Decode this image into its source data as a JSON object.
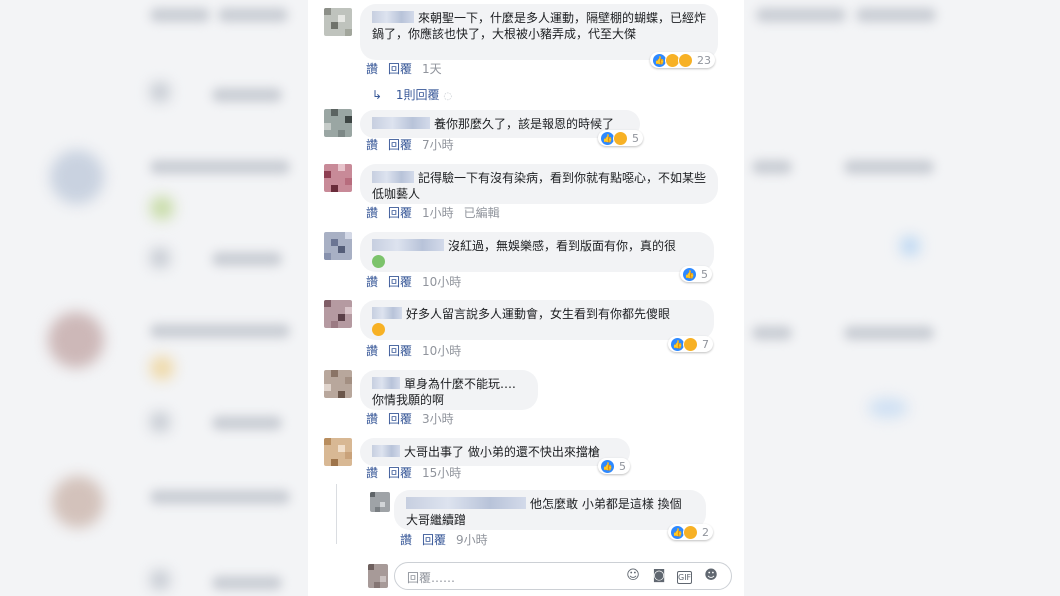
{
  "colors": {
    "link": "#385898",
    "meta_grey": "#90949c",
    "bubble_bg": "#f2f3f5",
    "like_blue": "#2e89ff",
    "haha_yellow": "#f7b125"
  },
  "actions": {
    "like": "讚",
    "reply": "回覆"
  },
  "comments": [
    {
      "text": "來朝聖一下，什麼是多人運動，隔壁棚的蝴蝶，已經炸鍋了，你應該也快了，大根被小豬弄成，代至大傑",
      "time": "1天",
      "reaction_count": "23",
      "reaction_icons": [
        "like-icon",
        "haha-icon",
        "wow-icon"
      ]
    },
    {
      "text": "養你那麼久了，該是報恩的時候了",
      "time": "7小時",
      "reaction_count": "5",
      "reaction_icons": [
        "like-icon",
        "haha-icon"
      ]
    },
    {
      "text": "記得驗一下有沒有染病，看到你就有點噁心，不如某些低咖藝人",
      "time": "1小時",
      "edited": "已編輯"
    },
    {
      "text": "沒紅過，無娛樂感，看到版面有你，真的很",
      "emoji": "nauseated-face-emoji",
      "time": "10小時",
      "reaction_count": "5",
      "reaction_icons": [
        "like-icon"
      ]
    },
    {
      "text": "好多人留言說多人運動會，女生看到有你都先傻眼",
      "emoji": "grimacing-face-emoji",
      "time": "10小時",
      "reaction_count": "7",
      "reaction_icons": [
        "like-icon",
        "haha-icon"
      ]
    },
    {
      "text_line1": "單身為什麼不能玩….",
      "text_line2": "你情我願的啊",
      "time": "3小時"
    },
    {
      "text": "大哥出事了 做小弟的還不快出來擋槍",
      "time": "15小時",
      "reaction_count": "5",
      "reaction_icons": [
        "like-icon"
      ]
    }
  ],
  "thread": {
    "replies_link": "1則回覆"
  },
  "nested_reply": {
    "text_line1": "他怎麼敢 小弟都是這樣 換個",
    "text_line2": "大哥繼續蹭",
    "time": "9小時",
    "reaction_count": "2",
    "reaction_icons": [
      "like-icon",
      "haha-icon"
    ]
  },
  "reply_box": {
    "placeholder": "回覆……",
    "icons": [
      "emoji-smile-icon",
      "camera-icon",
      "gif-icon",
      "sticker-icon"
    ]
  }
}
